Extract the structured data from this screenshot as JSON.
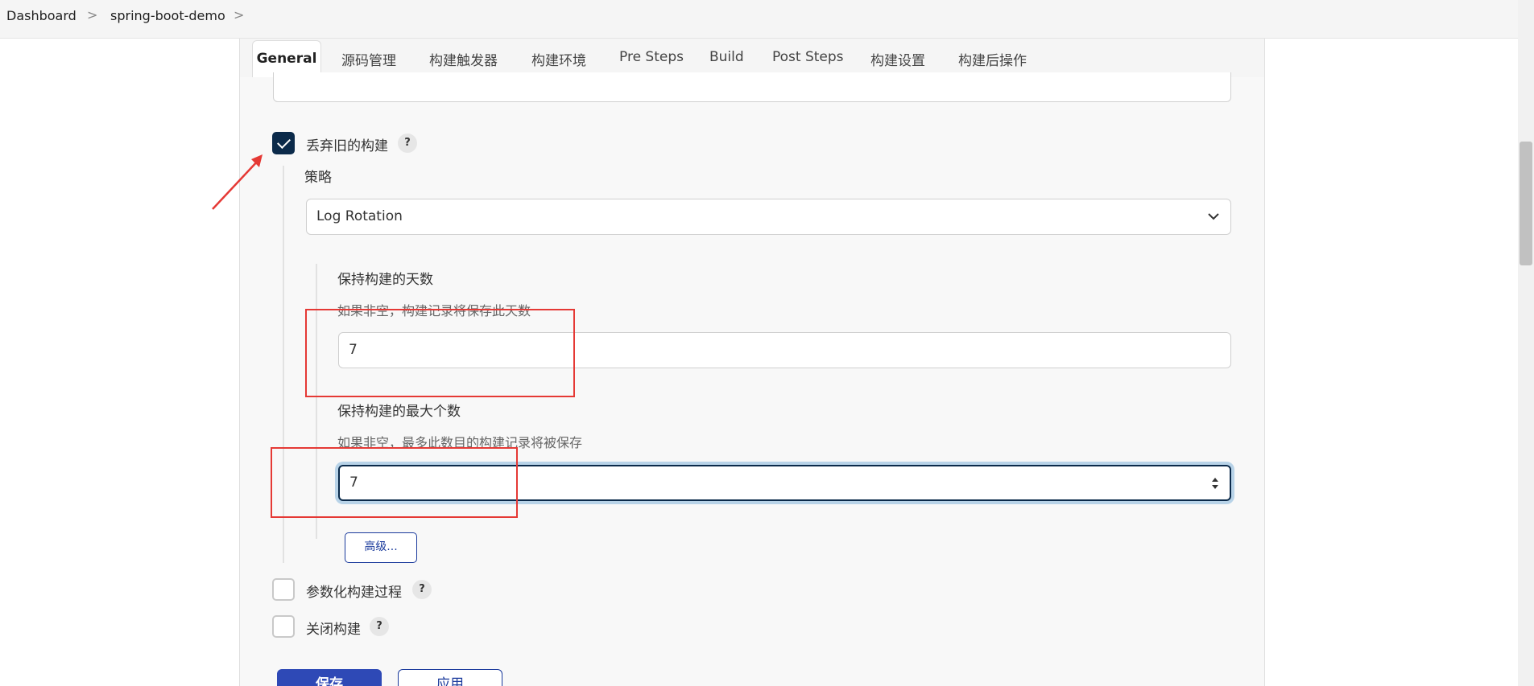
{
  "breadcrumb": {
    "items": [
      "Dashboard",
      "spring-boot-demo"
    ],
    "separator": ">"
  },
  "tabs": [
    {
      "label": "General",
      "active": true
    },
    {
      "label": "源码管理"
    },
    {
      "label": "构建触发器"
    },
    {
      "label": "构建环境"
    },
    {
      "label": "Pre Steps"
    },
    {
      "label": "Build"
    },
    {
      "label": "Post Steps"
    },
    {
      "label": "构建设置"
    },
    {
      "label": "构建后操作"
    }
  ],
  "discard_old_builds": {
    "label": "丢弃旧的构建",
    "checked": true,
    "help": "?",
    "strategy_label": "策略",
    "strategy_value": "Log Rotation",
    "days_to_keep": {
      "title": "保持构建的天数",
      "hint": "如果非空，构建记录将保存此天数",
      "value": "7"
    },
    "max_builds": {
      "title": "保持构建的最大个数",
      "hint": "如果非空，最多此数目的构建记录将被保存",
      "value": "7"
    },
    "advanced_label": "高级..."
  },
  "parameterized": {
    "label": "参数化构建过程",
    "checked": false,
    "help": "?"
  },
  "disable_build": {
    "label": "关闭构建",
    "checked": false,
    "help": "?"
  },
  "actions": {
    "save_label": "保存",
    "apply_label": "应用"
  },
  "colors": {
    "accent": "#0b2a4a",
    "primary_button": "#2e49b6",
    "annotation": "#e53935",
    "focus_ring": "#b8d3e8"
  }
}
